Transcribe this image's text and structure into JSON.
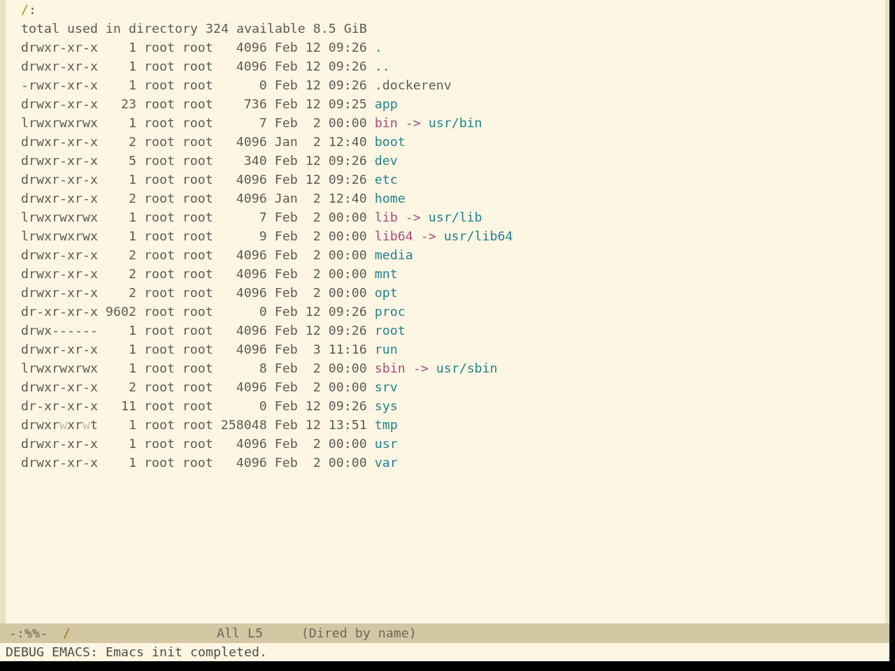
{
  "buffer": {
    "header": {
      "directory": "/",
      "separator": ":"
    },
    "summary": "total used in directory 324 available 8.5 GiB",
    "entries": [
      {
        "kind": "directory",
        "permissions": [
          {
            "text": "drwxr-xr-x",
            "dim": false
          }
        ],
        "links": "1",
        "owner": "root",
        "group": "root",
        "size": "4096",
        "month": "Feb",
        "day": "12",
        "time": "09:26",
        "name": "."
      },
      {
        "kind": "directory",
        "permissions": [
          {
            "text": "drwxr-xr-x",
            "dim": false
          }
        ],
        "links": "1",
        "owner": "root",
        "group": "root",
        "size": "4096",
        "month": "Feb",
        "day": "12",
        "time": "09:26",
        "name": ".."
      },
      {
        "kind": "file",
        "permissions": [
          {
            "text": "-rwxr-xr-x",
            "dim": false
          }
        ],
        "links": "1",
        "owner": "root",
        "group": "root",
        "size": "0",
        "month": "Feb",
        "day": "12",
        "time": "09:26",
        "name": ".dockerenv"
      },
      {
        "kind": "directory",
        "permissions": [
          {
            "text": "drwxr-xr-x",
            "dim": false
          }
        ],
        "links": "23",
        "owner": "root",
        "group": "root",
        "size": "736",
        "month": "Feb",
        "day": "12",
        "time": "09:25",
        "name": "app"
      },
      {
        "kind": "symlink",
        "permissions": [
          {
            "text": "lrwxrwxrwx",
            "dim": false
          }
        ],
        "links": "1",
        "owner": "root",
        "group": "root",
        "size": "7",
        "month": "Feb",
        "day": "2",
        "time": "00:00",
        "name": "bin",
        "arrow": "->",
        "target": "usr/bin"
      },
      {
        "kind": "directory",
        "permissions": [
          {
            "text": "drwxr-xr-x",
            "dim": false
          }
        ],
        "links": "2",
        "owner": "root",
        "group": "root",
        "size": "4096",
        "month": "Jan",
        "day": "2",
        "time": "12:40",
        "name": "boot"
      },
      {
        "kind": "directory",
        "permissions": [
          {
            "text": "drwxr-xr-x",
            "dim": false
          }
        ],
        "links": "5",
        "owner": "root",
        "group": "root",
        "size": "340",
        "month": "Feb",
        "day": "12",
        "time": "09:26",
        "name": "dev"
      },
      {
        "kind": "directory",
        "permissions": [
          {
            "text": "drwxr-xr-x",
            "dim": false
          }
        ],
        "links": "1",
        "owner": "root",
        "group": "root",
        "size": "4096",
        "month": "Feb",
        "day": "12",
        "time": "09:26",
        "name": "etc"
      },
      {
        "kind": "directory",
        "permissions": [
          {
            "text": "drwxr-xr-x",
            "dim": false
          }
        ],
        "links": "2",
        "owner": "root",
        "group": "root",
        "size": "4096",
        "month": "Jan",
        "day": "2",
        "time": "12:40",
        "name": "home"
      },
      {
        "kind": "symlink",
        "permissions": [
          {
            "text": "lrwxrwxrwx",
            "dim": false
          }
        ],
        "links": "1",
        "owner": "root",
        "group": "root",
        "size": "7",
        "month": "Feb",
        "day": "2",
        "time": "00:00",
        "name": "lib",
        "arrow": "->",
        "target": "usr/lib"
      },
      {
        "kind": "symlink",
        "permissions": [
          {
            "text": "lrwxrwxrwx",
            "dim": false
          }
        ],
        "links": "1",
        "owner": "root",
        "group": "root",
        "size": "9",
        "month": "Feb",
        "day": "2",
        "time": "00:00",
        "name": "lib64",
        "arrow": "->",
        "target": "usr/lib64"
      },
      {
        "kind": "directory",
        "permissions": [
          {
            "text": "drwxr-xr-x",
            "dim": false
          }
        ],
        "links": "2",
        "owner": "root",
        "group": "root",
        "size": "4096",
        "month": "Feb",
        "day": "2",
        "time": "00:00",
        "name": "media"
      },
      {
        "kind": "directory",
        "permissions": [
          {
            "text": "drwxr-xr-x",
            "dim": false
          }
        ],
        "links": "2",
        "owner": "root",
        "group": "root",
        "size": "4096",
        "month": "Feb",
        "day": "2",
        "time": "00:00",
        "name": "mnt"
      },
      {
        "kind": "directory",
        "permissions": [
          {
            "text": "drwxr-xr-x",
            "dim": false
          }
        ],
        "links": "2",
        "owner": "root",
        "group": "root",
        "size": "4096",
        "month": "Feb",
        "day": "2",
        "time": "00:00",
        "name": "opt"
      },
      {
        "kind": "directory",
        "permissions": [
          {
            "text": "dr-xr-xr-x",
            "dim": false
          }
        ],
        "links": "9602",
        "owner": "root",
        "group": "root",
        "size": "0",
        "month": "Feb",
        "day": "12",
        "time": "09:26",
        "name": "proc"
      },
      {
        "kind": "directory",
        "permissions": [
          {
            "text": "drwx------",
            "dim": false
          }
        ],
        "links": "1",
        "owner": "root",
        "group": "root",
        "size": "4096",
        "month": "Feb",
        "day": "12",
        "time": "09:26",
        "name": "root"
      },
      {
        "kind": "directory",
        "permissions": [
          {
            "text": "drwxr-xr-x",
            "dim": false
          }
        ],
        "links": "1",
        "owner": "root",
        "group": "root",
        "size": "4096",
        "month": "Feb",
        "day": "3",
        "time": "11:16",
        "name": "run"
      },
      {
        "kind": "symlink",
        "permissions": [
          {
            "text": "lrwxrwxrwx",
            "dim": false
          }
        ],
        "links": "1",
        "owner": "root",
        "group": "root",
        "size": "8",
        "month": "Feb",
        "day": "2",
        "time": "00:00",
        "name": "sbin",
        "arrow": "->",
        "target": "usr/sbin"
      },
      {
        "kind": "directory",
        "permissions": [
          {
            "text": "drwxr-xr-x",
            "dim": false
          }
        ],
        "links": "2",
        "owner": "root",
        "group": "root",
        "size": "4096",
        "month": "Feb",
        "day": "2",
        "time": "00:00",
        "name": "srv"
      },
      {
        "kind": "directory",
        "permissions": [
          {
            "text": "dr-xr-xr-x",
            "dim": false
          }
        ],
        "links": "11",
        "owner": "root",
        "group": "root",
        "size": "0",
        "month": "Feb",
        "day": "12",
        "time": "09:26",
        "name": "sys"
      },
      {
        "kind": "directory",
        "permissions": [
          {
            "text": "drwxr",
            "dim": false
          },
          {
            "text": "w",
            "dim": true
          },
          {
            "text": "xr",
            "dim": false
          },
          {
            "text": "w",
            "dim": true
          },
          {
            "text": "t",
            "dim": false
          }
        ],
        "links": "1",
        "owner": "root",
        "group": "root",
        "size": "258048",
        "month": "Feb",
        "day": "12",
        "time": "13:51",
        "name": "tmp"
      },
      {
        "kind": "directory",
        "permissions": [
          {
            "text": "drwxr-xr-x",
            "dim": false
          }
        ],
        "links": "1",
        "owner": "root",
        "group": "root",
        "size": "4096",
        "month": "Feb",
        "day": "2",
        "time": "00:00",
        "name": "usr"
      },
      {
        "kind": "directory",
        "permissions": [
          {
            "text": "drwxr-xr-x",
            "dim": false
          }
        ],
        "links": "1",
        "owner": "root",
        "group": "root",
        "size": "4096",
        "month": "Feb",
        "day": "2",
        "time": "00:00",
        "name": "var"
      }
    ]
  },
  "mode_line": {
    "status": "-:%%-",
    "buffer_name": "/",
    "position": "All L5",
    "mode": "(Dired by name)"
  },
  "echo_area": "DEBUG EMACS: Emacs init completed."
}
